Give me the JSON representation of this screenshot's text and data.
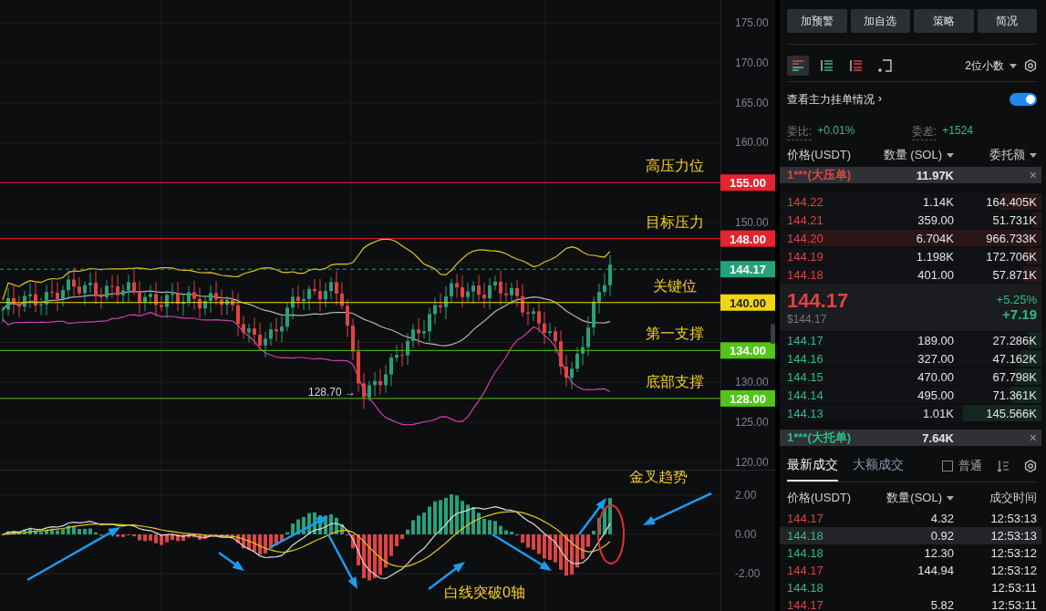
{
  "price_chart": {
    "y_ticks": [
      "175.00",
      "170.00",
      "165.00",
      "160.00",
      "150.00",
      "130.00",
      "125.00",
      "120.00"
    ],
    "levels": [
      {
        "label": "高压力位",
        "price": "155.00",
        "color": "#e8222e"
      },
      {
        "label": "目标压力",
        "price": "148.00",
        "color": "#e8222e"
      },
      {
        "label": "关键位",
        "price": "140.00",
        "color": "#f2d410"
      },
      {
        "label": "第一支撑",
        "price": "134.00",
        "color": "#52c41a"
      },
      {
        "label": "底部支撑",
        "price": "128.00",
        "color": "#52c41a"
      }
    ],
    "current": {
      "price": "144.17",
      "color": "#26a17b"
    },
    "low_marker": "128.70 →"
  },
  "macd_chart": {
    "y_ticks": [
      "2.00",
      "0.00",
      "-2.00"
    ],
    "notes": [
      "金叉趋势",
      "白线突破0轴"
    ]
  },
  "actions": [
    "加预警",
    "加自选",
    "策略",
    "简况"
  ],
  "views": [
    {
      "kind": "both",
      "selected": true
    },
    {
      "kind": "bids",
      "selected": false
    },
    {
      "kind": "asks",
      "selected": false
    },
    {
      "kind": "custom",
      "selected": false
    }
  ],
  "precision": "2位小数",
  "main_orders": {
    "label": "查看主力挂单情况",
    "chevron": "›",
    "on": true
  },
  "ratio": {
    "label": "委比:",
    "value": "+0.01%"
  },
  "diff": {
    "label": "委差:",
    "value": "+1524"
  },
  "book_columns": [
    "价格(USDT)",
    "数量 (SOL)",
    "委托额"
  ],
  "big_ask": {
    "label": "1***(大压单)",
    "amount": "11.97K",
    "close": "×"
  },
  "asks": [
    {
      "price": "144.22",
      "qty": "1.14K",
      "total": "164.405K",
      "level": 0.16
    },
    {
      "price": "144.21",
      "qty": "359.00",
      "total": "51.731K",
      "level": 0.03
    },
    {
      "price": "144.20",
      "qty": "6.704K",
      "total": "966.733K",
      "level": 0.92
    },
    {
      "price": "144.19",
      "qty": "1.198K",
      "total": "172.706K",
      "level": 0.06
    },
    {
      "price": "144.18",
      "qty": "401.00",
      "total": "57.871K",
      "level": 0.07
    }
  ],
  "last": {
    "price": "144.17",
    "usd": "$144.17",
    "change_pct": "+5.25%",
    "change": "+7.19"
  },
  "bids": [
    {
      "price": "144.17",
      "qty": "189.00",
      "total": "27.286K",
      "level": 0.05
    },
    {
      "price": "144.16",
      "qty": "327.00",
      "total": "47.162K",
      "level": 0.08
    },
    {
      "price": "144.15",
      "qty": "470.00",
      "total": "67.798K",
      "level": 0.1
    },
    {
      "price": "144.14",
      "qty": "495.00",
      "total": "71.361K",
      "level": 0.12
    },
    {
      "price": "144.13",
      "qty": "1.01K",
      "total": "145.566K",
      "level": 0.3
    }
  ],
  "big_bid": {
    "label": "1***(大托单)",
    "amount": "7.64K",
    "close": "×"
  },
  "trade_tabs": [
    {
      "label": "最新成交",
      "selected": true
    },
    {
      "label": "大额成交",
      "selected": false
    }
  ],
  "trade_filter": {
    "label": "普通",
    "checked": false
  },
  "trade_columns": [
    "价格(USDT)",
    "数量(SOL)",
    "成交时间"
  ],
  "trades": [
    {
      "price": "144.17",
      "qty": "4.32",
      "time": "12:53:13",
      "color": "#e04343",
      "selected": false
    },
    {
      "price": "144.18",
      "qty": "0.92",
      "time": "12:53:13",
      "color": "#2ebd85",
      "selected": true
    },
    {
      "price": "144.18",
      "qty": "12.30",
      "time": "12:53:12",
      "color": "#2ebd85",
      "selected": false
    },
    {
      "price": "144.17",
      "qty": "144.94",
      "time": "12:53:12",
      "color": "#e04343",
      "selected": false
    },
    {
      "price": "144.18",
      "time": "12:53:11",
      "color": "#2ebd85",
      "selected": false
    },
    {
      "price": "144.17",
      "qty": "5.82",
      "time": "12:53:11",
      "color": "#e04343",
      "selected": false
    }
  ]
}
